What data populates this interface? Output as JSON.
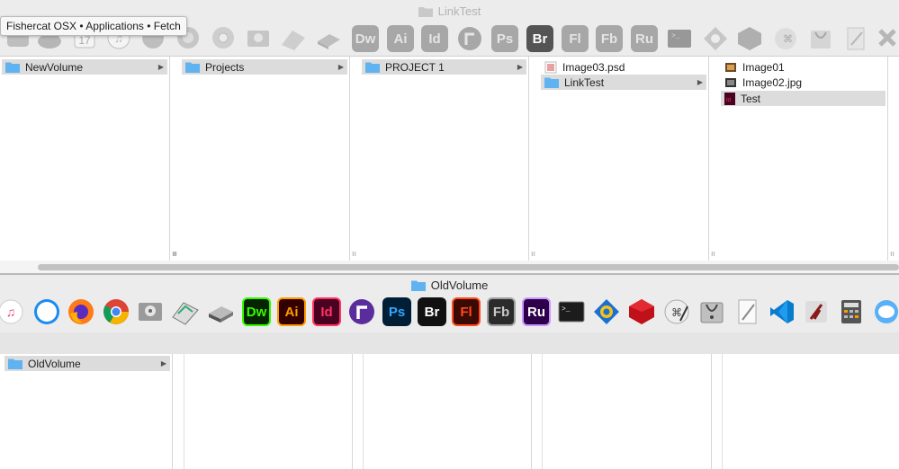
{
  "top_window": {
    "title": "LinkTest",
    "tooltip": "Fishercat OSX • Applications • Fetch",
    "toolbar_icons": [
      "finder-icon",
      "fetch-icon",
      "calendar-icon",
      "itunes-icon",
      "safari-icon",
      "firefox-icon",
      "chrome-icon",
      "disk-utility-icon",
      "image-capture-icon",
      "scanner-icon",
      "dreamweaver-icon",
      "illustrator-icon",
      "indesign-icon",
      "fontlab-icon",
      "photoshop-icon",
      "bridge-icon",
      "flash-icon",
      "flash-builder-icon",
      "rush-icon",
      "terminal-icon",
      "mail-icon",
      "cube-icon",
      "script-editor-icon",
      "system-info-icon",
      "text-edit-icon",
      "vscode-icon"
    ],
    "columns": [
      {
        "items": [
          {
            "label": "NewVolume",
            "type": "folder",
            "selected": true,
            "has_children": true
          }
        ]
      },
      {
        "items": [
          {
            "label": "Projects",
            "type": "folder",
            "selected": true,
            "has_children": true
          }
        ]
      },
      {
        "items": [
          {
            "label": "PROJECT 1",
            "type": "folder",
            "selected": true,
            "has_children": true
          }
        ]
      },
      {
        "items": [
          {
            "label": "Image03.psd",
            "type": "psd",
            "selected": false,
            "has_children": false
          },
          {
            "label": "LinkTest",
            "type": "folder",
            "selected": true,
            "has_children": true
          }
        ]
      },
      {
        "items": [
          {
            "label": "Image01",
            "type": "image",
            "selected": false,
            "has_children": false
          },
          {
            "label": "Image02.jpg",
            "type": "jpg",
            "selected": false,
            "has_children": false
          },
          {
            "label": "Test",
            "type": "indd",
            "selected": true,
            "has_children": false
          }
        ]
      }
    ]
  },
  "bottom_window": {
    "title": "OldVolume",
    "toolbar_labels": {
      "dw": "Dw",
      "ai": "Ai",
      "id": "Id",
      "ps": "Ps",
      "br": "Br",
      "fl": "Fl",
      "fb": "Fb",
      "ru": "Ru",
      "top_dw": "Dw",
      "top_ai": "Ai",
      "top_id": "Id",
      "top_ps": "Ps",
      "top_br": "Br",
      "top_fl": "Fl",
      "top_fb": "Fb",
      "top_ru": "Ru"
    },
    "columns": [
      {
        "items": [
          {
            "label": "OldVolume",
            "type": "folder",
            "selected": true,
            "has_children": true
          }
        ]
      },
      {
        "items": []
      },
      {
        "items": []
      },
      {
        "items": []
      },
      {
        "items": []
      }
    ]
  },
  "colors": {
    "folder_blue": "#5fb3f0",
    "selection": "#dcdcdc",
    "dw": "#35fa00",
    "ai": "#ff9a00",
    "id": "#ff3366",
    "ps": "#31a8ff",
    "fl": "#ff4a1f",
    "fb": "#a0a0a0",
    "ru": "#c896ff"
  }
}
